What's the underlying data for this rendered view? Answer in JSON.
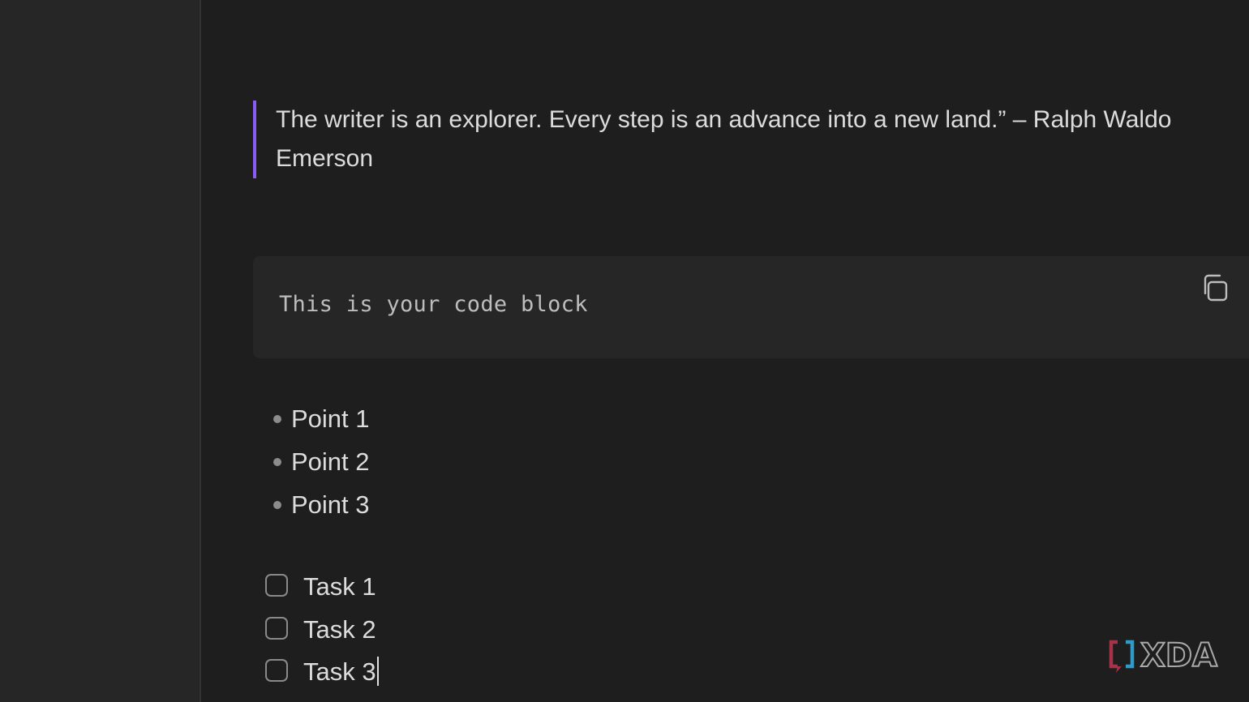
{
  "blockquote": {
    "text": "The writer is an explorer. Every step is an advance into a new land.” – Ralph Waldo Emerson"
  },
  "code_block": {
    "text": "This is your code block",
    "copy_icon": "copy-icon"
  },
  "bullets": [
    {
      "label": "Point 1"
    },
    {
      "label": "Point 2"
    },
    {
      "label": "Point 3"
    }
  ],
  "tasks": [
    {
      "label": "Task 1",
      "checked": false
    },
    {
      "label": "Task 2",
      "checked": false
    },
    {
      "label": "Task 3",
      "checked": false
    }
  ],
  "watermark": {
    "text": "XDA"
  },
  "colors": {
    "background": "#1e1e1e",
    "sidebar": "#262626",
    "accent": "#8a5cf5",
    "code_background": "#262626"
  }
}
